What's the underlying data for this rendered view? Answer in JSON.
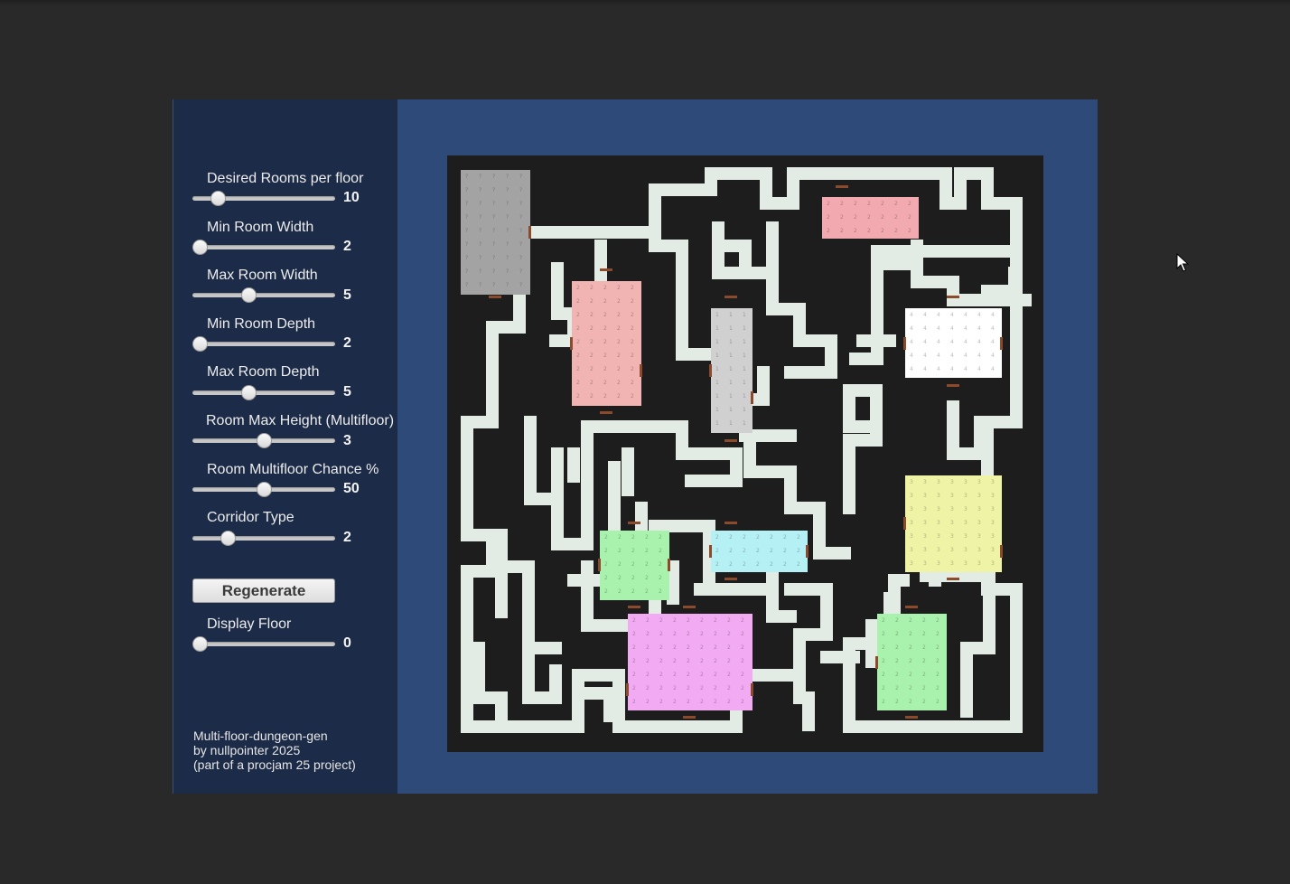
{
  "panel": {
    "sliders": [
      {
        "label": "Desired Rooms per floor",
        "value": "10",
        "fraction": 0.14
      },
      {
        "label": "Min Room Width",
        "value": "2",
        "fraction": 0.0
      },
      {
        "label": "Max Room Width",
        "value": "5",
        "fraction": 0.38
      },
      {
        "label": "Min Room Depth",
        "value": "2",
        "fraction": 0.0
      },
      {
        "label": "Max Room Depth",
        "value": "5",
        "fraction": 0.38
      },
      {
        "label": "Room Max Height (Multifloor)",
        "value": "3",
        "fraction": 0.5
      },
      {
        "label": "Room Multifloor Chance %",
        "value": "50",
        "fraction": 0.5
      },
      {
        "label": "Corridor Type",
        "value": "2",
        "fraction": 0.22
      }
    ],
    "regenerate_label": "Regenerate",
    "display_floor": {
      "label": "Display Floor",
      "value": "0",
      "fraction": 0.0
    },
    "credits": [
      "Multi-floor-dungeon-gen",
      "by nullpointer 2025",
      "(part of a procjam 25 project)"
    ]
  },
  "map": {
    "floor": 0,
    "colors": {
      "background": "#1d1d1d",
      "corridor": "#e3ebe5",
      "door": "#8b4a2b",
      "rooms": [
        "#a3a3a3",
        "#f2b3b3",
        "#d0d0d0",
        "#f2a9af",
        "#ffffff",
        "#eef3a6",
        "#a9f2ad",
        "#b5f0f5",
        "#f2aaf2",
        "#a9f2ad"
      ]
    },
    "room_marks": [
      "?",
      "2",
      "1",
      "2",
      "4",
      "3",
      "2",
      "2",
      "2",
      "2"
    ]
  }
}
